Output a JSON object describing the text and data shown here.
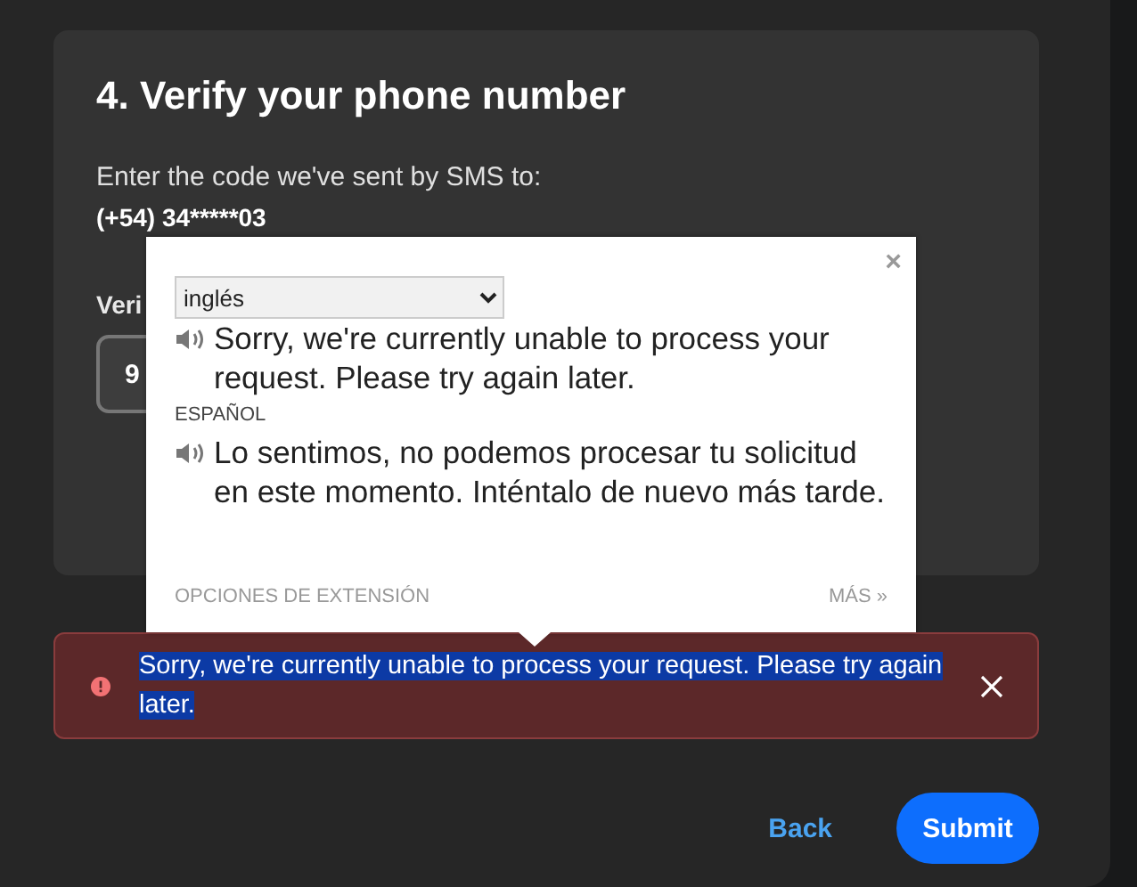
{
  "step": {
    "title": "4. Verify your phone number",
    "instructions": "Enter the code we've sent by SMS to:",
    "phone": "(+54) 34*****03",
    "field_label": "Veri",
    "code_value": "9"
  },
  "translate_popup": {
    "close": "×",
    "language": "inglés",
    "source_text": "Sorry, we're currently unable to process your request. Please try again later.",
    "target_language": "ESPAÑOL",
    "translation": "Lo sentimos, no podemos procesar tu solicitud en este momento. Inténtalo de nuevo más tarde.",
    "options_link": "OPCIONES DE EXTENSIÓN",
    "more_link": "MÁS »"
  },
  "error": {
    "message": "Sorry, we're currently unable to process your request. Please try again later.",
    "selected": true
  },
  "buttons": {
    "back": "Back",
    "submit": "Submit"
  }
}
